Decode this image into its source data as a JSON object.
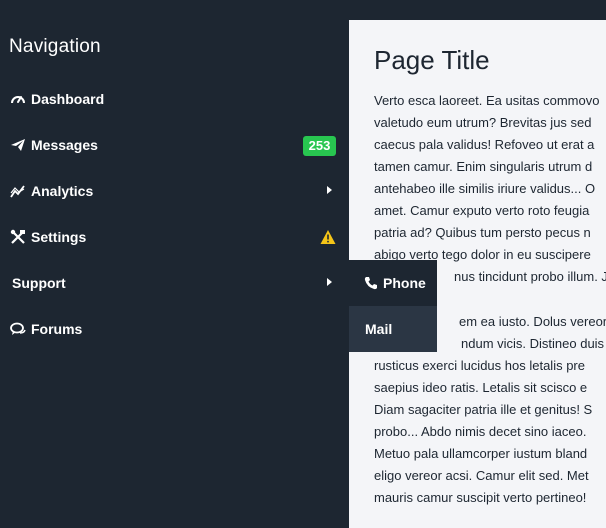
{
  "sidebar": {
    "title": "Navigation",
    "items": [
      {
        "label": "Dashboard",
        "icon": "gauge-icon"
      },
      {
        "label": "Messages",
        "icon": "paper-plane-icon",
        "badge": "253",
        "badge_color": "#28c650"
      },
      {
        "label": "Analytics",
        "icon": "chart-line-icon",
        "has_submenu": true
      },
      {
        "label": "Settings",
        "icon": "tools-icon",
        "warning_icon": "warning-icon",
        "warning_color": "#f5c518"
      },
      {
        "label": "Support",
        "has_submenu": true,
        "active_submenu": true
      },
      {
        "label": "Forums",
        "icon": "chat-bubbles-icon"
      }
    ]
  },
  "submenu": {
    "items": [
      {
        "label": "Phone",
        "icon": "phone-icon"
      },
      {
        "label": "Mail"
      }
    ]
  },
  "main": {
    "title": "Page Title",
    "paragraph1": [
      "Verto esca laoreet. Ea usitas commovo",
      "valetudo eum utrum? Brevitas jus sed",
      "caecus pala validus! Refoveo ut erat a",
      "tamen camur. Enim singularis utrum d",
      "antehabeo ille similis iriure validus... O",
      "amet. Camur exputo verto roto feugia",
      "patria ad? Quibus tum persto pecus n",
      "abigo verto tego dolor in eu suscipere",
      "nus tincidunt probo illum. Ju"
    ],
    "paragraph2": [
      "em ea iusto. Dolus vereor b",
      "ndum vicis. Distineo duis du",
      "rusticus exerci lucidus hos letalis pre",
      "saepius ideo ratis. Letalis sit scisco e",
      "Diam sagaciter patria ille et genitus! S",
      "probo... Abdo nimis decet sino iaceo.",
      "Metuo pala ullamcorper iustum bland",
      "eligo vereor acsi. Camur elit sed. Met",
      "mauris camur suscipit verto pertineo!"
    ]
  },
  "colors": {
    "sidebar_bg": "#1d2631",
    "content_bg": "#f4f5f8",
    "submenu_active_bg": "#2b3644",
    "badge_green": "#28c650",
    "warning_yellow": "#f5c518"
  }
}
